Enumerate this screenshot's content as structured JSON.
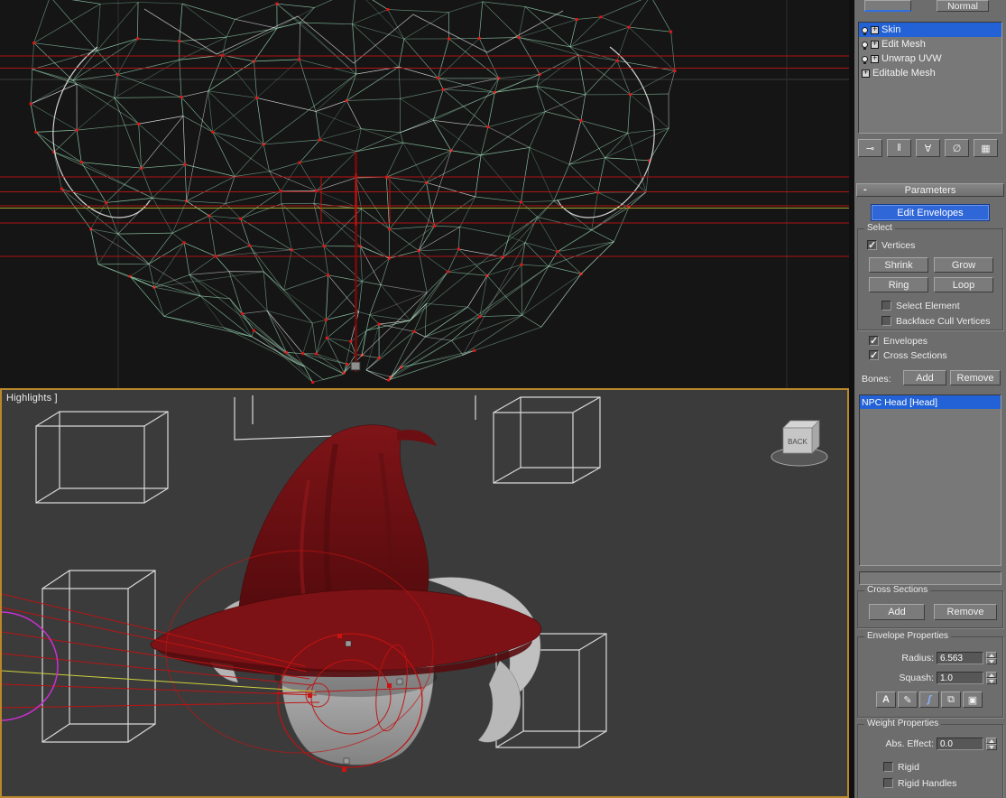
{
  "toolbar": {
    "normal_label": "Normal"
  },
  "modifier_stack": {
    "items": [
      {
        "label": "Skin",
        "selected": true
      },
      {
        "label": "Edit Mesh",
        "selected": false
      },
      {
        "label": "Unwrap UVW",
        "selected": false
      },
      {
        "label": "Editable Mesh",
        "selected": false
      }
    ],
    "tools": [
      {
        "glyph": "⊸"
      },
      {
        "glyph": "‖"
      },
      {
        "glyph": "∀"
      },
      {
        "glyph": "∅"
      },
      {
        "glyph": "▦"
      }
    ]
  },
  "parameters": {
    "collapse_glyph": "-",
    "header": "Parameters",
    "edit_envelopes_label": "Edit Envelopes",
    "select_group": {
      "label": "Select",
      "vertices": {
        "label": "Vertices",
        "checked": true
      },
      "shrink_label": "Shrink",
      "grow_label": "Grow",
      "ring_label": "Ring",
      "loop_label": "Loop",
      "select_element": {
        "label": "Select Element",
        "checked": false
      },
      "backface": {
        "label": "Backface Cull Vertices",
        "checked": false
      }
    },
    "envelopes": {
      "label": "Envelopes",
      "checked": true
    },
    "cross_sections": {
      "label": "Cross Sections",
      "checked": true
    },
    "bones": {
      "label": "Bones:",
      "add_label": "Add",
      "remove_label": "Remove",
      "list": [
        {
          "label": "NPC Head [Head]",
          "selected": true
        }
      ]
    },
    "cross_sections_group": {
      "label": "Cross Sections",
      "add_label": "Add",
      "remove_label": "Remove"
    },
    "envelope_properties": {
      "label": "Envelope Properties",
      "radius_label": "Radius:",
      "radius_value": "6.563",
      "squash_label": "Squash:",
      "squash_value": "1.0",
      "icons": [
        {
          "glyph": "A"
        },
        {
          "glyph": "✎"
        },
        {
          "glyph": "ʃ"
        },
        {
          "glyph": "⧉"
        },
        {
          "glyph": "▣"
        }
      ]
    },
    "weight_properties": {
      "label": "Weight Properties",
      "abs_effect_label": "Abs. Effect:",
      "abs_effect_value": "0.0",
      "rigid": {
        "label": "Rigid",
        "checked": false
      },
      "rigid_handles": {
        "label": "Rigid Handles",
        "checked": false
      }
    }
  },
  "viewport": {
    "bottom_label": "Highlights ]",
    "back_helper_label": "BACK"
  },
  "colors": {
    "selection_blue": "#2262d6",
    "active_viewport_border": "#b9882a",
    "wireframe_green": "#9fe3bd",
    "envelope_red": "#c01212"
  }
}
